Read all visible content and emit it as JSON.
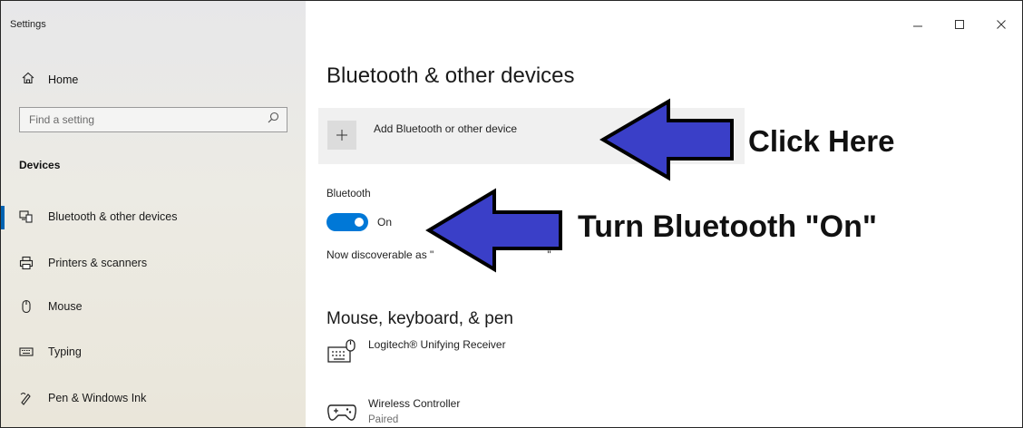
{
  "window": {
    "title": "Settings",
    "controls": [
      {
        "name": "minimize-button",
        "symbol": "—"
      },
      {
        "name": "maximize-button",
        "symbol": "□"
      },
      {
        "name": "close-button",
        "symbol": "✕"
      }
    ]
  },
  "sidebar": {
    "home_label": "Home",
    "search_placeholder": "Find a setting",
    "section_title": "Devices",
    "items": [
      {
        "label": "Bluetooth & other devices",
        "icon": "bluetooth-devices-icon",
        "active": true
      },
      {
        "label": "Printers & scanners",
        "icon": "printer-icon"
      },
      {
        "label": "Mouse",
        "icon": "mouse-icon"
      },
      {
        "label": "Typing",
        "icon": "keyboard-icon"
      },
      {
        "label": "Pen & Windows Ink",
        "icon": "pen-icon"
      }
    ]
  },
  "main": {
    "title": "Bluetooth & other devices",
    "add_device_label": "Add Bluetooth or other device",
    "bluetooth_label": "Bluetooth",
    "bluetooth_state": "On",
    "discoverable_text": "Now discoverable as \"",
    "discoverable_end": "\"",
    "section_title": "Mouse, keyboard, & pen",
    "devices": [
      {
        "name": "Logitech® Unifying Receiver",
        "status": "",
        "icon": "keyboard-device-icon"
      },
      {
        "name": "Wireless Controller",
        "status": "Paired",
        "icon": "gamepad-icon"
      }
    ]
  },
  "annotations": {
    "click_here": "Click Here",
    "turn_on": "Turn Bluetooth \"On\""
  },
  "colors": {
    "accent": "#0078d7",
    "arrow_fill": "#3a3fc8",
    "arrow_stroke": "#000000"
  }
}
